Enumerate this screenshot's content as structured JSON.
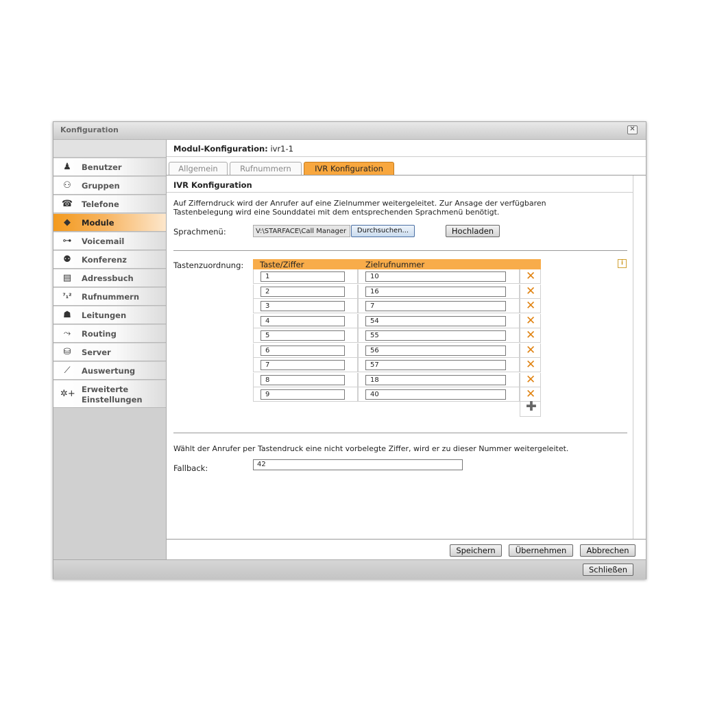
{
  "window": {
    "title": "Konfiguration",
    "close_icon": "close-icon",
    "close_glyph": "✕"
  },
  "sidebar": {
    "items": [
      {
        "label": "Benutzer",
        "icon": "user-icon",
        "glyph": "♟"
      },
      {
        "label": "Gruppen",
        "icon": "group-icon",
        "glyph": "⚇"
      },
      {
        "label": "Telefone",
        "icon": "phone-icon",
        "glyph": "☎"
      },
      {
        "label": "Module",
        "icon": "module-box-icon",
        "glyph": "◆"
      },
      {
        "label": "Voicemail",
        "icon": "voicemail-icon",
        "glyph": "⊶"
      },
      {
        "label": "Konferenz",
        "icon": "conference-icon",
        "glyph": "⚉"
      },
      {
        "label": "Adressbuch",
        "icon": "addressbook-icon",
        "glyph": "▤"
      },
      {
        "label": "Rufnummern",
        "icon": "numbers-icon",
        "glyph": "⁷₁²"
      },
      {
        "label": "Leitungen",
        "icon": "line-icon",
        "glyph": "☗"
      },
      {
        "label": "Routing",
        "icon": "routing-icon",
        "glyph": "⤳"
      },
      {
        "label": "Server",
        "icon": "server-icon",
        "glyph": "⛁"
      },
      {
        "label": "Auswertung",
        "icon": "chart-icon",
        "glyph": "⟋"
      },
      {
        "label": "Erweiterte Einstellungen",
        "icon": "advanced-settings-icon",
        "glyph": "✲+"
      }
    ]
  },
  "header": {
    "label": "Modul-Konfiguration:",
    "value": "ivr1-1"
  },
  "tabs": [
    {
      "label": "Allgemein"
    },
    {
      "label": "Rufnummern"
    },
    {
      "label": "IVR Konfiguration"
    }
  ],
  "ivr": {
    "title": "IVR Konfiguration",
    "description": "Auf Zifferndruck wird der Anrufer auf eine Zielnummer weitergeleitet. Zur Ansage der verfügbaren Tastenbelegung wird eine Sounddatei mit dem entsprechenden Sprachmenü benötigt.",
    "sprachmenu_label": "Sprachmenü:",
    "path_value": "V:\\STARFACE\\Call Manager",
    "browse_label": "Durchsuchen...",
    "upload_label": "Hochladen",
    "mapping_label": "Tastenzuordnung:",
    "col_key": "Taste/Ziffer",
    "col_target": "Zielrufnummer",
    "rows": [
      {
        "key": "1",
        "target": "10"
      },
      {
        "key": "2",
        "target": "16"
      },
      {
        "key": "3",
        "target": "7"
      },
      {
        "key": "4",
        "target": "54"
      },
      {
        "key": "5",
        "target": "55"
      },
      {
        "key": "6",
        "target": "56"
      },
      {
        "key": "7",
        "target": "57"
      },
      {
        "key": "8",
        "target": "18"
      },
      {
        "key": "9",
        "target": "40"
      }
    ],
    "delete_glyph": "✕",
    "add_glyph": "✚",
    "info_glyph": "i",
    "fallback_desc": "Wählt der Anrufer per Tastendruck eine nicht vorbelegte Ziffer, wird er zu dieser Nummer weitergeleitet.",
    "fallback_label": "Fallback:",
    "fallback_value": "42"
  },
  "footer": {
    "save": "Speichern",
    "apply": "Übernehmen",
    "cancel": "Abbrechen",
    "close": "Schließen"
  },
  "colors": {
    "accent": "#f8a73e",
    "delete": "#e08312"
  }
}
